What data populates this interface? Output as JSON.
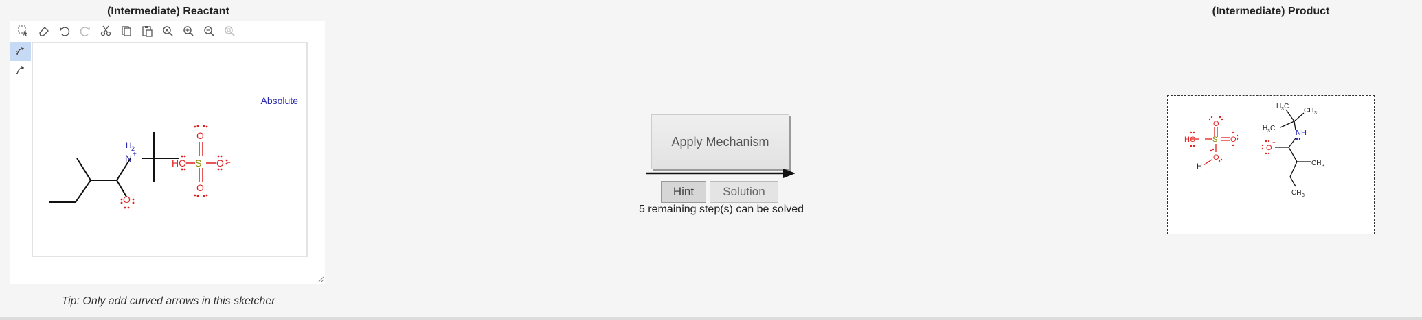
{
  "reactant": {
    "title": "(Intermediate) Reactant",
    "absolute_label": "Absolute",
    "tip": "Tip: Only add curved arrows in this sketcher"
  },
  "product": {
    "title": "(Intermediate) Product"
  },
  "toolbar": {
    "icons": [
      "select-icon",
      "eraser-icon",
      "undo-icon",
      "redo-icon",
      "cut-icon",
      "copy-icon",
      "paste-icon",
      "zoom-fit-icon",
      "zoom-in-icon",
      "zoom-out-icon",
      "zoom-reset-icon"
    ]
  },
  "actions": {
    "apply_label": "Apply Mechanism",
    "hint_label": "Hint",
    "solution_label": "Solution",
    "remaining_text": "5 remaining step(s) can be solved"
  },
  "molecule_labels": {
    "nh2": "H",
    "nh2_sub": "2",
    "n": "N",
    "ho": "HO",
    "s": "S",
    "o": "O",
    "h": "H",
    "nh": "NH",
    "c": "C",
    "ch3": "CH",
    "sub3": "3",
    "plus": "+",
    "minus": "−"
  },
  "colors": {
    "accent_red": "#e02020",
    "accent_blue": "#2b2bb0",
    "sulfur": "#8a8a00",
    "active_tool": "#c7daf5"
  }
}
